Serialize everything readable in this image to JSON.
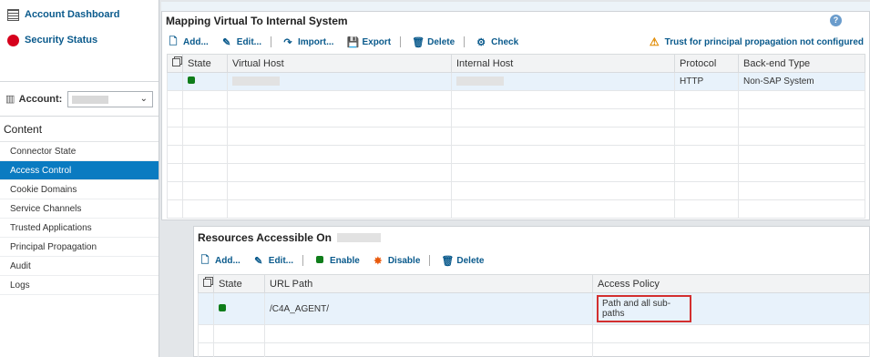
{
  "sidebar": {
    "links": [
      {
        "label": "Account Dashboard",
        "icon": "table-icon"
      },
      {
        "label": "Security Status",
        "icon": "red-status-icon"
      }
    ],
    "account_label": "Account:",
    "content_header": "Content",
    "menu": [
      "Connector State",
      "Access Control",
      "Cookie Domains",
      "Service Channels",
      "Trusted Applications",
      "Principal Propagation",
      "Audit",
      "Logs"
    ],
    "active_item": "Access Control"
  },
  "mapping": {
    "title": "Mapping Virtual To Internal System",
    "toolbar": {
      "add": "Add...",
      "edit": "Edit...",
      "import": "Import...",
      "export": "Export",
      "delete": "Delete",
      "check": "Check"
    },
    "warning": "Trust for principal propagation not configured",
    "columns": [
      "State",
      "Virtual Host",
      "Internal Host",
      "Protocol",
      "Back-end Type"
    ],
    "row": {
      "protocol": "HTTP",
      "backend_type": "Non-SAP System"
    }
  },
  "resources": {
    "title": "Resources Accessible On",
    "toolbar": {
      "add": "Add...",
      "edit": "Edit...",
      "enable": "Enable",
      "disable": "Disable",
      "delete": "Delete"
    },
    "columns": [
      "State",
      "URL Path",
      "Access Policy"
    ],
    "row": {
      "url_path": "/C4A_AGENT/",
      "access_policy": "Path and all sub-paths"
    }
  },
  "colors": {
    "accent": "#0a7bc1",
    "link": "#0a5a8c",
    "status_ok": "#0f7d1a",
    "alert": "#d6001c",
    "highlight": "#d32f2f"
  }
}
